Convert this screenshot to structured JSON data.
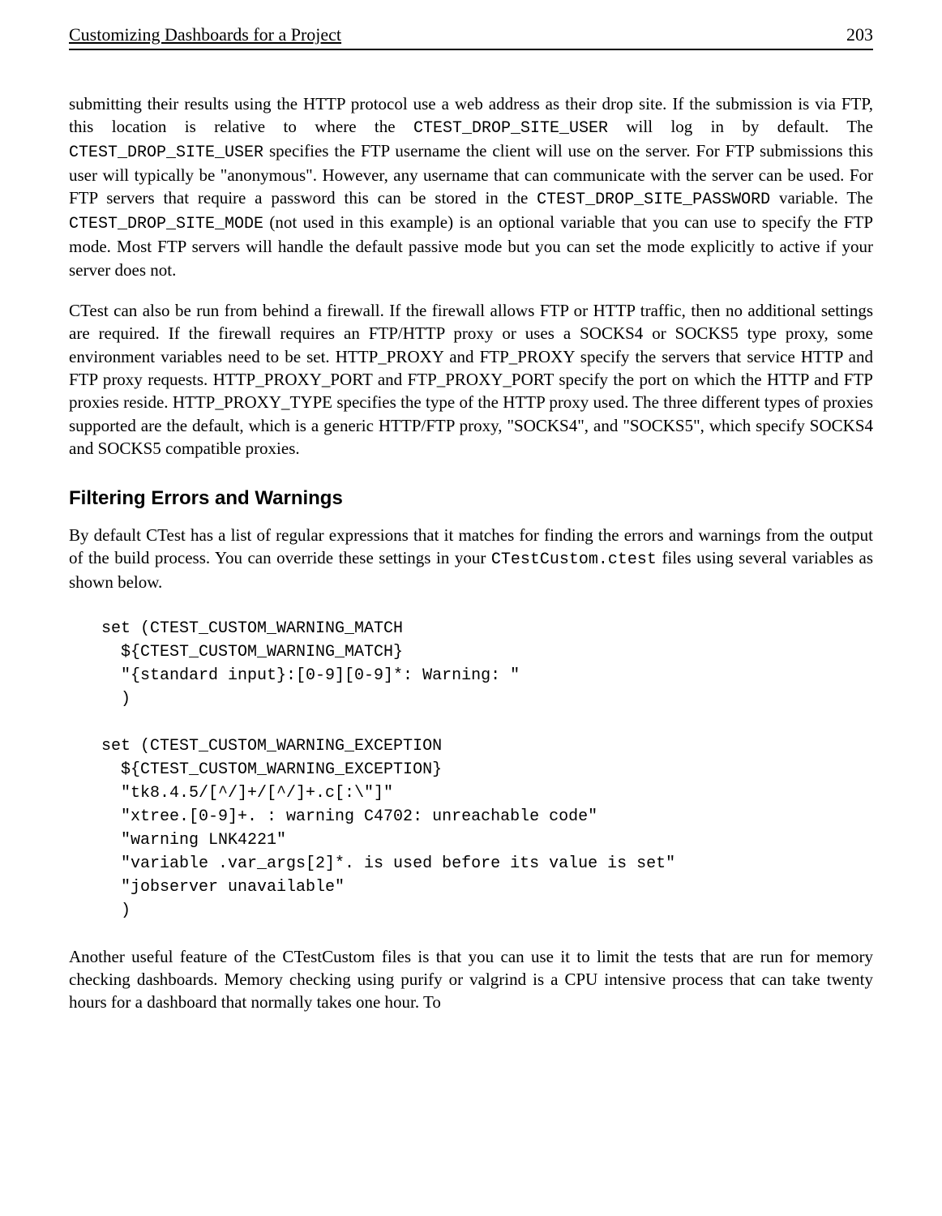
{
  "header": {
    "title": "Customizing Dashboards for a Project",
    "page": "203"
  },
  "para1": {
    "t1": "submitting their results using the HTTP protocol use a web address as their drop site. If the submission is via FTP, this location is relative to where the ",
    "c1": "CTEST_DROP_SITE_USER",
    "t2": " will log in by default. The ",
    "c2": "CTEST_DROP_SITE_USER",
    "t3": " specifies the FTP username the client will use on the server. For FTP submissions this user will typically be \"anonymous\". However, any username that can communicate with the server can be used. For FTP servers that require a password this can be stored in the ",
    "c3": "CTEST_DROP_SITE_PASSWORD",
    "t4": " variable. The ",
    "c4": "CTEST_DROP_SITE_MODE",
    "t5": " (not used in this example) is an optional variable that you can use to specify the FTP mode. Most FTP servers will handle the default passive mode but you can set the mode explicitly to active if your server does not."
  },
  "para2": "CTest can also be run from behind a firewall. If the firewall allows FTP or HTTP traffic, then no additional settings are required. If the firewall requires an FTP/HTTP proxy or uses a SOCKS4 or SOCKS5 type proxy, some environment variables need to be set. HTTP_PROXY and FTP_PROXY specify the servers that service HTTP and FTP proxy requests. HTTP_PROXY_PORT and FTP_PROXY_PORT specify the port on which the HTTP and FTP proxies reside. HTTP_PROXY_TYPE specifies the type of the HTTP proxy used. The three different types of proxies supported are the default, which is a generic HTTP/FTP proxy, \"SOCKS4\", and \"SOCKS5\", which specify SOCKS4 and SOCKS5 compatible proxies.",
  "section_heading": "Filtering Errors and Warnings",
  "para3": {
    "t1": "By default CTest has a list of regular expressions that it matches for finding the errors and warnings from the output of the build process. You can override these settings in your ",
    "c1": "CTestCustom.ctest",
    "t2": " files using several variables as shown below."
  },
  "code": "set (CTEST_CUSTOM_WARNING_MATCH\n  ${CTEST_CUSTOM_WARNING_MATCH}\n  \"{standard input}:[0-9][0-9]*: Warning: \"\n  )\n\nset (CTEST_CUSTOM_WARNING_EXCEPTION\n  ${CTEST_CUSTOM_WARNING_EXCEPTION}\n  \"tk8.4.5/[^/]+/[^/]+.c[:\\\"]\"\n  \"xtree.[0-9]+. : warning C4702: unreachable code\"\n  \"warning LNK4221\"\n  \"variable .var_args[2]*. is used before its value is set\"\n  \"jobserver unavailable\"\n  )",
  "para4": "Another useful feature of the CTestCustom files is that you can use it to limit the tests that are run for memory checking dashboards. Memory checking using purify or valgrind is a CPU intensive process that can take twenty hours for a dashboard that normally takes one hour. To"
}
